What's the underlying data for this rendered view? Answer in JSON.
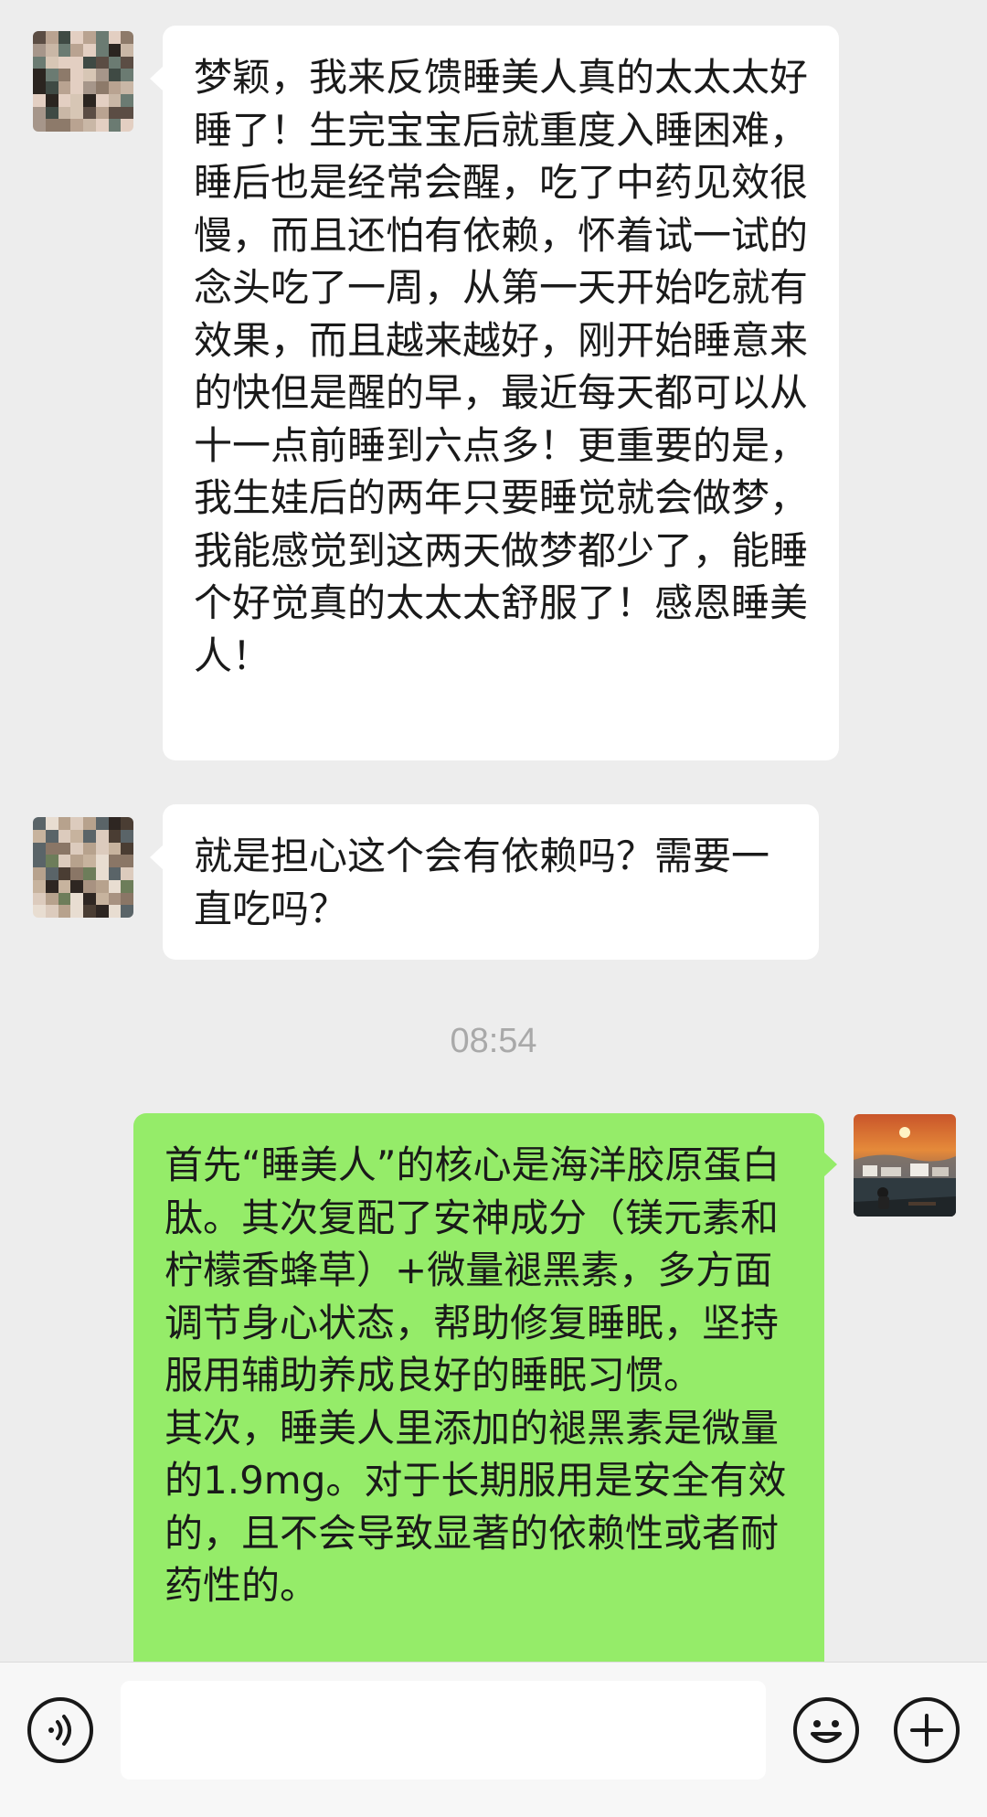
{
  "messages": [
    {
      "side": "left",
      "text": "梦颖，我来反馈睡美人真的太太太好睡了！生完宝宝后就重度入睡困难，睡后也是经常会醒，吃了中药见效很慢，而且还怕有依赖，怀着试一试的念头吃了一周，从第一天开始吃就有效果，而且越来越好，刚开始睡意来的快但是醒的早，最近每天都可以从十一点前睡到六点多！更重要的是，我生娃后的两年只要睡觉就会做梦，我能感觉到这两天做梦都少了，能睡个好觉真的太太太舒服了！感恩睡美人！"
    },
    {
      "side": "left",
      "text": "就是担心这个会有依赖吗？需要一直吃吗？"
    },
    {
      "side": "right",
      "text": "首先“睡美人”的核心是海洋胶原蛋白肽。其次复配了安神成分（镁元素和柠檬香蜂草）+微量褪黑素，多方面调节身心状态，帮助修复睡眠，坚持服用辅助养成良好的睡眠习惯。\n其次，睡美人里添加的褪黑素是微量的1.9mg。对于长期服用是安全有效的，且不会导致显著的依赖性或者耐药性的。"
    }
  ],
  "timestamp": "08:54",
  "input": {
    "placeholder": ""
  },
  "icons": {
    "voice": "voice-icon",
    "emoji": "emoji-icon",
    "add": "plus-icon"
  },
  "colors": {
    "background": "#ededed",
    "sent_bubble": "#95ec69",
    "received_bubble": "#ffffff"
  }
}
